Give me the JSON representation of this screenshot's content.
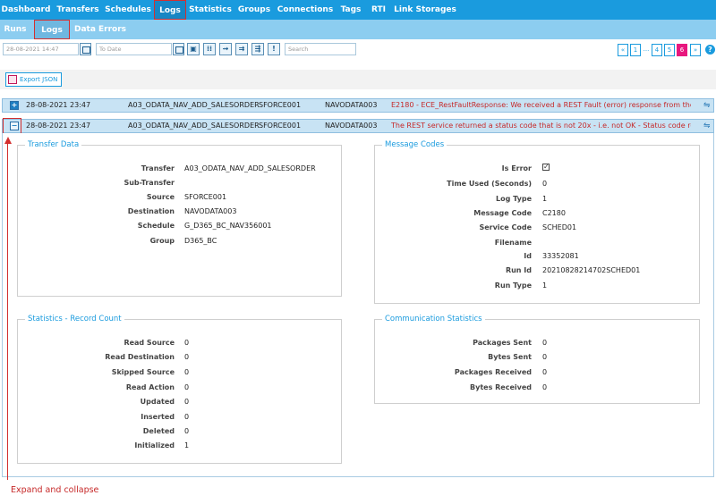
{
  "topnav": {
    "items": [
      {
        "label": "Dashboard"
      },
      {
        "label": "Transfers"
      },
      {
        "label": "Schedules"
      },
      {
        "label": "Logs"
      },
      {
        "label": "Statistics"
      },
      {
        "label": "Groups"
      },
      {
        "label": "Connections"
      },
      {
        "label": "Tags"
      },
      {
        "label": "RTI"
      },
      {
        "label": "Link Storages"
      }
    ],
    "active": "Logs"
  },
  "subnav": {
    "items": [
      {
        "label": "Runs"
      },
      {
        "label": "Logs"
      },
      {
        "label": "Data Errors"
      }
    ],
    "active": "Logs"
  },
  "filters": {
    "from_date_placeholder": "28-08-2021 14:47",
    "to_date_placeholder": "To Date",
    "search_placeholder": "Search"
  },
  "pagination": {
    "prev": "«",
    "pages": [
      "1",
      "...",
      "4",
      "5",
      "6"
    ],
    "active": "6",
    "next": "»",
    "help": "?"
  },
  "export_label": "Export JSON",
  "rows": [
    {
      "toggle": "+",
      "datetime": "28-08-2021 23:47",
      "transfer": "A03_ODATA_NAV_ADD_SALESORDER",
      "source": "SFORCE001",
      "destination": "NAVODATA003",
      "message": "E2180 - ECE_RestFaultResponse: We received a REST Fault (error) response from the s..."
    },
    {
      "toggle": "−",
      "datetime": "28-08-2021 23:47",
      "transfer": "A03_ODATA_NAV_ADD_SALESORDER",
      "source": "SFORCE001",
      "destination": "NAVODATA003",
      "message": "The REST service returned a status code that is not 20x - i.e. not OK - Status code rec..."
    }
  ],
  "transfer_data": {
    "title": "Transfer Data",
    "fields": [
      {
        "k": "Transfer",
        "v": "A03_ODATA_NAV_ADD_SALESORDER"
      },
      {
        "k": "Sub-Transfer",
        "v": ""
      },
      {
        "k": "Source",
        "v": "SFORCE001"
      },
      {
        "k": "Destination",
        "v": "NAVODATA003"
      },
      {
        "k": "Schedule",
        "v": "G_D365_BC_NAV356001"
      },
      {
        "k": "Group",
        "v": "D365_BC"
      }
    ]
  },
  "message_codes": {
    "title": "Message Codes",
    "is_error_label": "Is Error",
    "is_error_checked": true,
    "check_glyph": "✓",
    "fields": [
      {
        "k": "Time Used (Seconds)",
        "v": "0"
      },
      {
        "k": "Log Type",
        "v": "1"
      },
      {
        "k": "Message Code",
        "v": "C2180"
      },
      {
        "k": "Service Code",
        "v": "SCHED01"
      },
      {
        "k": "Filename",
        "v": ""
      },
      {
        "k": "Id",
        "v": "33352081"
      },
      {
        "k": "Run Id",
        "v": "20210828214702SCHED01"
      },
      {
        "k": "Run Type",
        "v": "1"
      }
    ]
  },
  "record_count": {
    "title": "Statistics - Record Count",
    "fields": [
      {
        "k": "Read Source",
        "v": "0"
      },
      {
        "k": "Read Destination",
        "v": "0"
      },
      {
        "k": "Skipped Source",
        "v": "0"
      },
      {
        "k": "Read Action",
        "v": "0"
      },
      {
        "k": "Updated",
        "v": "0"
      },
      {
        "k": "Inserted",
        "v": "0"
      },
      {
        "k": "Deleted",
        "v": "0"
      },
      {
        "k": "Initialized",
        "v": "1"
      }
    ]
  },
  "communication": {
    "title": "Communication Statistics",
    "fields": [
      {
        "k": "Packages Sent",
        "v": "0"
      },
      {
        "k": "Bytes Sent",
        "v": "0"
      },
      {
        "k": "Packages Received",
        "v": "0"
      },
      {
        "k": "Bytes Received",
        "v": "0"
      }
    ]
  },
  "annotation": "Expand and collapse",
  "colors": {
    "nav": "#1a9bde",
    "subnav": "#8ccdf0",
    "row": "#c8e3f4",
    "error_text": "#c62828",
    "annotation": "#d32f2f",
    "active_page": "#e8177e"
  }
}
